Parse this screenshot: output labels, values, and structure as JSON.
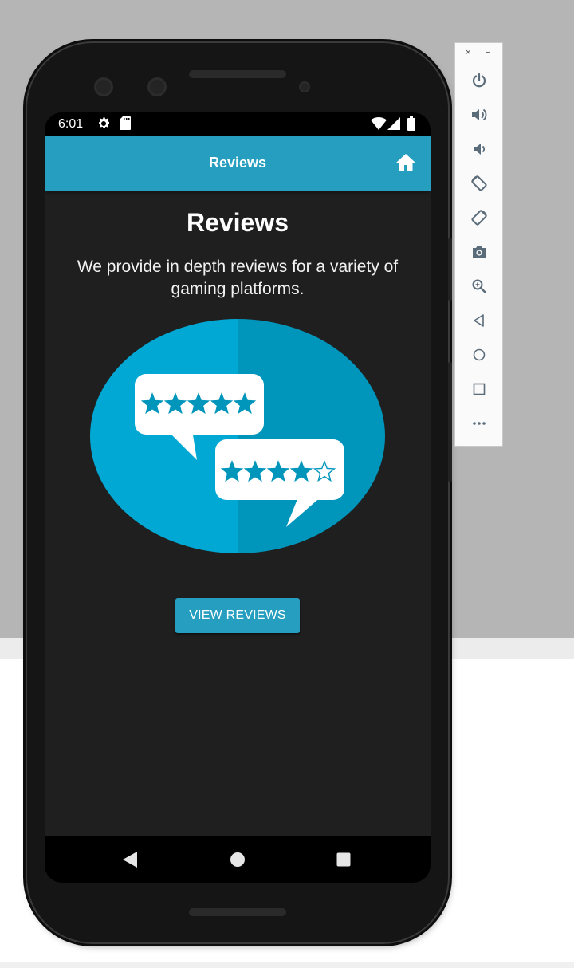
{
  "status_bar": {
    "time": "6:01",
    "icons": [
      "settings-icon",
      "sd-card-icon",
      "wifi-icon",
      "signal-icon",
      "battery-icon"
    ]
  },
  "app_bar": {
    "title": "Reviews",
    "action_icon": "home-icon"
  },
  "content": {
    "heading": "Reviews",
    "description": "We provide in depth reviews for a variety of gaming platforms.",
    "illustration": {
      "bubble_1_stars_filled": 5,
      "bubble_2_stars_filled": 4,
      "bubble_2_stars_total": 5
    },
    "button_label": "VIEW REVIEWS"
  },
  "nav_bar": [
    "back-icon",
    "home-circle-icon",
    "recents-icon"
  ],
  "emulator_toolbar": {
    "window_controls": [
      "×",
      "−"
    ],
    "buttons": [
      "power-icon",
      "volume-up-icon",
      "volume-down-icon",
      "rotate-left-icon",
      "rotate-right-icon",
      "camera-icon",
      "zoom-icon",
      "back-icon",
      "home-icon",
      "overview-icon",
      "more-icon"
    ]
  },
  "colors": {
    "accent": "#259ebf",
    "screen_bg": "#1f1f1f",
    "illustration_light": "#00a8d3",
    "illustration_dark": "#0095bb"
  }
}
